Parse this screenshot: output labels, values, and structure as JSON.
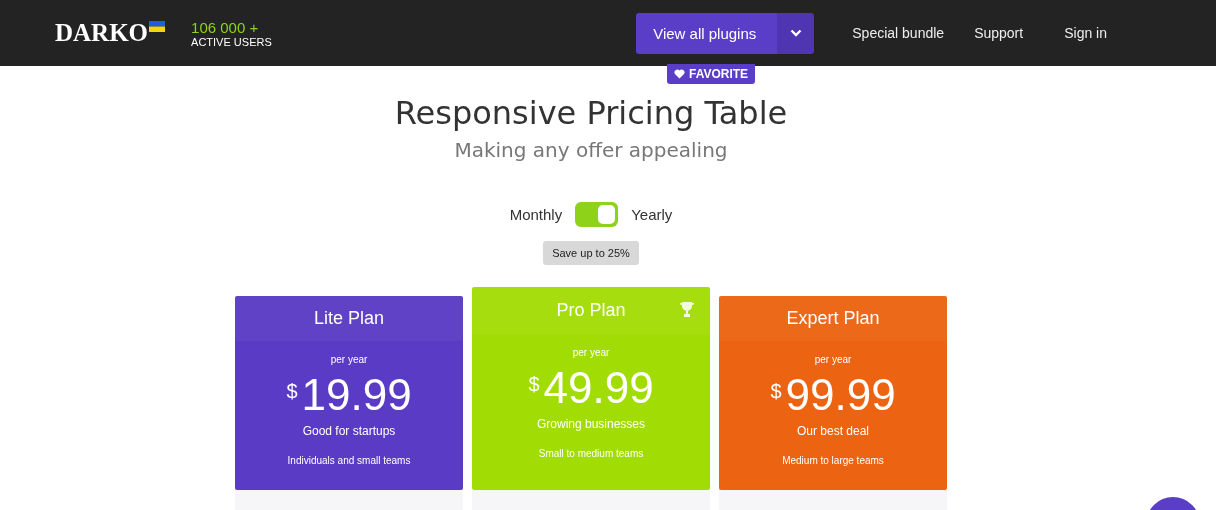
{
  "header": {
    "logo": "DARKO",
    "stats": {
      "count": "106 000 +",
      "label": "ACTIVE USERS"
    },
    "plugins_button": "View all plugins",
    "nav": [
      "Special bundle",
      "Support",
      "Sign in"
    ]
  },
  "badge": "FAVORITE",
  "title": "Responsive Pricing Table",
  "subtitle": "Making any offer appealing",
  "billing": {
    "left": "Monthly",
    "right": "Yearly",
    "on": true,
    "note": "Save up to 25%"
  },
  "plans": [
    {
      "name": "Lite Plan",
      "period": "per year",
      "currency": "$",
      "price": "19.99",
      "tagline": "Good for startups",
      "audience": "Individuals and small teams",
      "color": "#5a3bc5",
      "featured": false
    },
    {
      "name": "Pro Plan",
      "period": "per year",
      "currency": "$",
      "price": "49.99",
      "tagline": "Growing businesses",
      "audience": "Small to medium teams",
      "color": "#a2dc05",
      "featured": true
    },
    {
      "name": "Expert Plan",
      "period": "per year",
      "currency": "$",
      "price": "99.99",
      "tagline": "Our best deal",
      "audience": "Medium to large teams",
      "color": "#ec6311",
      "featured": false
    }
  ]
}
